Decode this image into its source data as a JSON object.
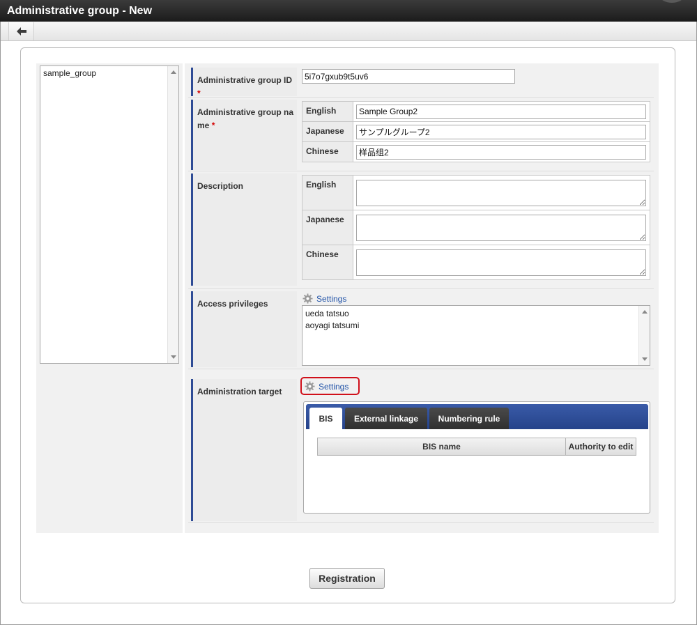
{
  "window": {
    "title": "Administrative group - New"
  },
  "toolbar": {
    "back_icon": "arrow-left-icon"
  },
  "group_list": {
    "items": [
      "sample_group"
    ]
  },
  "form": {
    "group_id": {
      "label": "Administrative group ID",
      "required_mark": "*",
      "value": "5i7o7gxub9t5uv6"
    },
    "group_name": {
      "label_line1": "Administrative group na",
      "label_line2": "me",
      "required_mark": "*",
      "rows": [
        {
          "lang": "English",
          "value": "Sample Group2"
        },
        {
          "lang": "Japanese",
          "value": "サンプルグループ2"
        },
        {
          "lang": "Chinese",
          "value": "样品组2"
        }
      ]
    },
    "description": {
      "label": "Description",
      "rows": [
        {
          "lang": "English",
          "value": ""
        },
        {
          "lang": "Japanese",
          "value": ""
        },
        {
          "lang": "Chinese",
          "value": ""
        }
      ]
    },
    "access_privileges": {
      "label": "Access privileges",
      "settings_label": "Settings",
      "users": [
        "ueda tatsuo",
        "aoyagi tatsumi"
      ]
    },
    "administration_target": {
      "label": "Administration target",
      "settings_label": "Settings",
      "tabs": [
        {
          "label": "BIS",
          "active": true
        },
        {
          "label": "External linkage",
          "active": false
        },
        {
          "label": "Numbering rule",
          "active": false
        }
      ],
      "columns": [
        "BIS name",
        "Authority to edit"
      ]
    }
  },
  "footer": {
    "register_label": "Registration"
  },
  "colors": {
    "accent": "#2e4b95",
    "link": "#2354a8",
    "highlight": "#d0101a",
    "required": "#d40000"
  }
}
